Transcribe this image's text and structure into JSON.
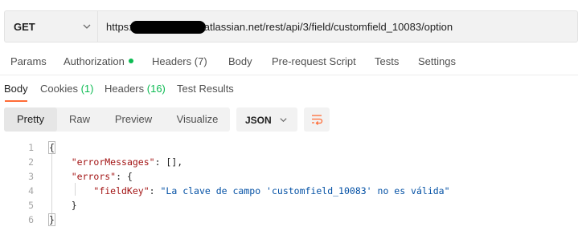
{
  "request": {
    "method": "GET",
    "url_prefix": "https:",
    "url_suffix": "atlassian.net/rest/api/3/field/customfield_10083/option"
  },
  "request_tabs": [
    {
      "label": "Params"
    },
    {
      "label": "Authorization"
    },
    {
      "label": "Headers",
      "count": "(7)"
    },
    {
      "label": "Body"
    },
    {
      "label": "Pre-request Script"
    },
    {
      "label": "Tests"
    },
    {
      "label": "Settings"
    }
  ],
  "response_tabs": [
    {
      "label": "Body"
    },
    {
      "label": "Cookies",
      "count": "(1)"
    },
    {
      "label": "Headers",
      "count": "(16)"
    },
    {
      "label": "Test Results"
    }
  ],
  "view_modes": [
    "Pretty",
    "Raw",
    "Preview",
    "Visualize"
  ],
  "format": "JSON",
  "code_lines": [
    {
      "n": "1",
      "parts": [
        {
          "t": "{",
          "c": "p"
        }
      ]
    },
    {
      "n": "2",
      "parts": [
        {
          "t": "    ",
          "c": "p"
        },
        {
          "t": "\"errorMessages\"",
          "c": "k"
        },
        {
          "t": ": [],",
          "c": "p"
        }
      ]
    },
    {
      "n": "3",
      "parts": [
        {
          "t": "    ",
          "c": "p"
        },
        {
          "t": "\"errors\"",
          "c": "k"
        },
        {
          "t": ": {",
          "c": "p"
        }
      ]
    },
    {
      "n": "4",
      "parts": [
        {
          "t": "        ",
          "c": "p"
        },
        {
          "t": "\"fieldKey\"",
          "c": "k"
        },
        {
          "t": ": ",
          "c": "p"
        },
        {
          "t": "\"La clave de campo 'customfield_10083' no es válida\"",
          "c": "s"
        }
      ]
    },
    {
      "n": "5",
      "parts": [
        {
          "t": "    }",
          "c": "p"
        }
      ]
    },
    {
      "n": "6",
      "parts": [
        {
          "t": "}",
          "c": "p"
        }
      ]
    }
  ],
  "colors": {
    "accent": "#ff6c37",
    "status_green": "#0cbb52"
  }
}
